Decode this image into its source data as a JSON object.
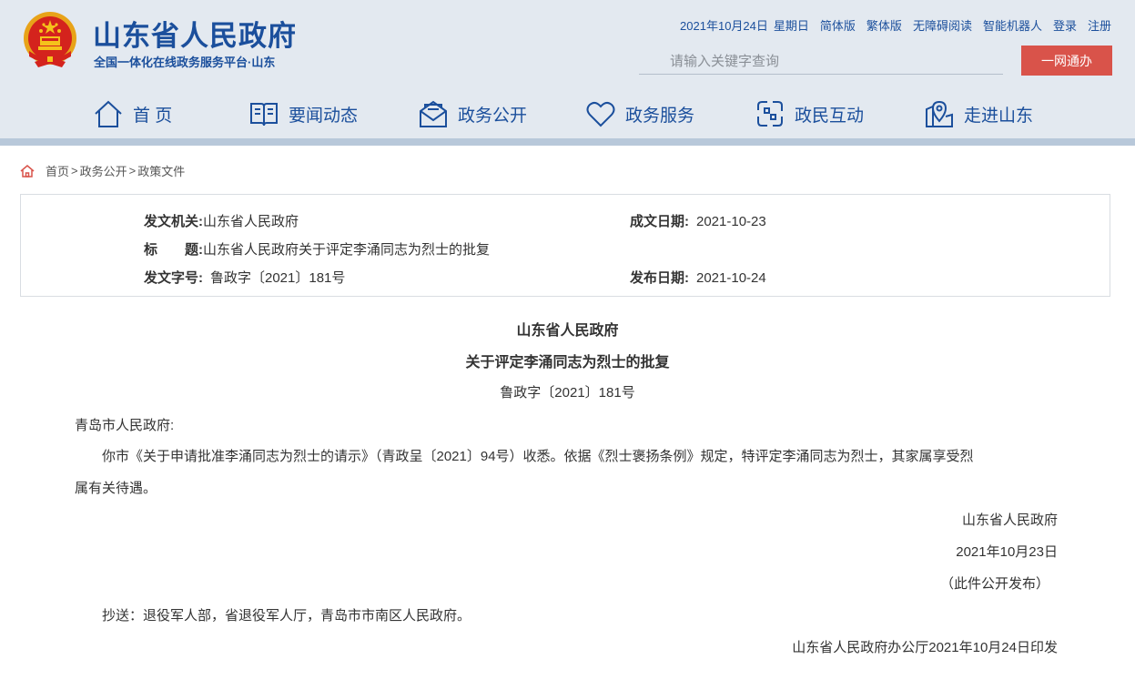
{
  "header": {
    "title": "山东省人民政府",
    "subtitle": "全国一体化在线政务服务平台·山东",
    "date": "2021年10月24日",
    "weekday": "星期日",
    "links": [
      "简体版",
      "繁体版",
      "无障碍阅读",
      "智能机器人",
      "登录",
      "注册"
    ],
    "search_placeholder": "请输入关键字查询",
    "yiwang_button": "一网通办",
    "colors": {
      "brand_blue": "#1b4f9c",
      "header_bg": "#e3e9f0",
      "accent_red": "#d9534a"
    }
  },
  "nav": [
    {
      "label": "首 页",
      "icon": "home-icon"
    },
    {
      "label": "要闻动态",
      "icon": "news-icon"
    },
    {
      "label": "政务公开",
      "icon": "mail-icon"
    },
    {
      "label": "政务服务",
      "icon": "heart-icon"
    },
    {
      "label": "政民互动",
      "icon": "exchange-icon"
    },
    {
      "label": "走进山东",
      "icon": "map-pin-icon"
    }
  ],
  "breadcrumb": [
    "首页",
    "政务公开",
    "政策文件"
  ],
  "breadcrumb_separator": ">",
  "info": {
    "issuer_label": "发文机关:",
    "issuer": "山东省人民政府",
    "created_label": "成文日期:",
    "created": "2021-10-23",
    "title_label": "标　　题:",
    "title": "山东省人民政府关于评定李涌同志为烈士的批复",
    "doc_no_label": "发文字号:",
    "doc_no": "鲁政字〔2021〕181号",
    "published_label": "发布日期:",
    "published": "2021-10-24"
  },
  "article": {
    "heading1": "山东省人民政府",
    "heading2": "关于评定李涌同志为烈士的批复",
    "doc_no": "鲁政字〔2021〕181号",
    "salutation": "青岛市人民政府:",
    "body_line1": "你市《关于申请批准李涌同志为烈士的请示》（青政呈〔2021〕94号）收悉。依据《烈士褒扬条例》规定，特评定李涌同志为烈士，其家属享受烈",
    "body_line2": "属有关待遇。",
    "sign_org": "山东省人民政府",
    "sign_date": "2021年10月23日",
    "publish_note": "（此件公开发布）",
    "cc": "抄送：退役军人部，省退役军人厅，青岛市市南区人民政府。",
    "print_note": "山东省人民政府办公厅2021年10月24日印发"
  }
}
